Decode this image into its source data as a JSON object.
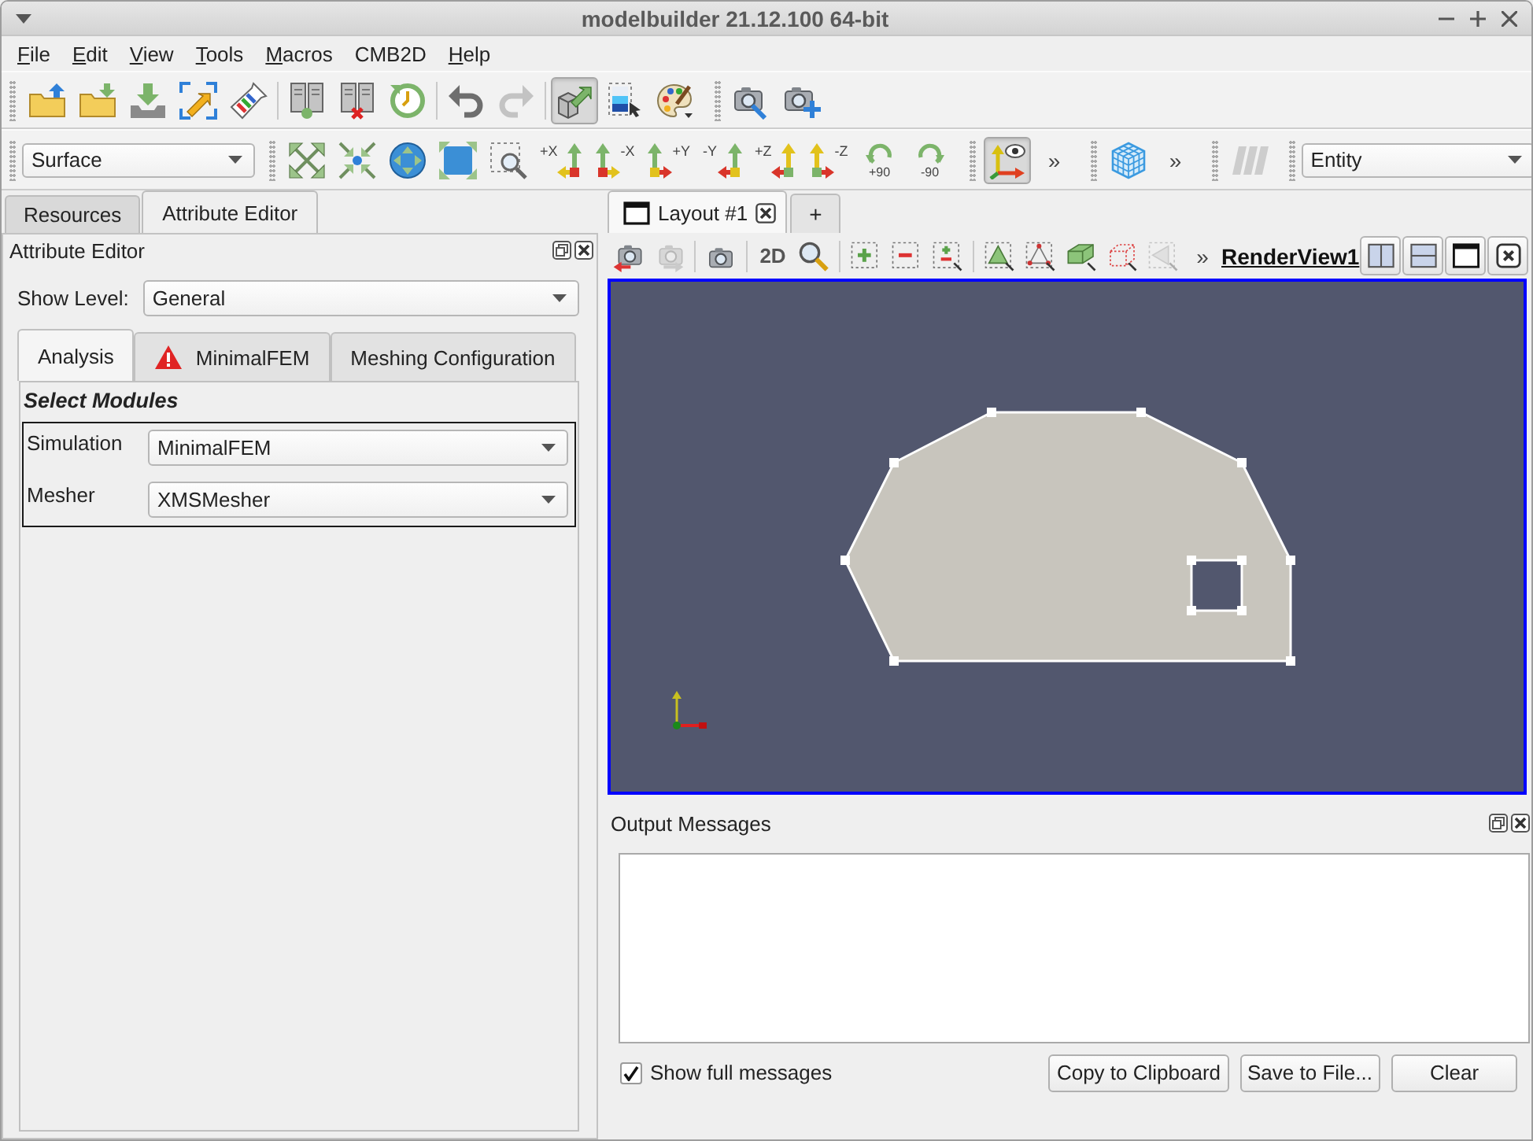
{
  "window": {
    "title": "modelbuilder 21.12.100 64-bit"
  },
  "menu": [
    {
      "label": "File",
      "mnemonic": true
    },
    {
      "label": "Edit",
      "mnemonic": true
    },
    {
      "label": "View",
      "mnemonic": true
    },
    {
      "label": "Tools",
      "mnemonic": true
    },
    {
      "label": "Macros",
      "mnemonic": true
    },
    {
      "label": "CMB2D",
      "mnemonic": false
    },
    {
      "label": "Help",
      "mnemonic": true
    }
  ],
  "toolbar_rows": [
    [
      {
        "groups": [
          [
            {
              "kind": "open",
              "pressed": false,
              "disabled": false
            },
            {
              "kind": "save",
              "pressed": false,
              "disabled": false
            },
            {
              "kind": "import",
              "pressed": false,
              "disabled": false
            },
            {
              "kind": "expand",
              "pressed": false,
              "disabled": false
            },
            {
              "kind": "flask",
              "pressed": false,
              "disabled": false
            }
          ],
          [
            {
              "kind": "connect",
              "pressed": false,
              "disabled": false
            },
            {
              "kind": "disconnect",
              "pressed": false,
              "disabled": false
            },
            {
              "kind": "reload",
              "pressed": false,
              "disabled": false
            }
          ],
          [
            {
              "kind": "undo",
              "pressed": false,
              "disabled": false
            },
            {
              "kind": "redo",
              "pressed": false,
              "disabled": true
            }
          ],
          [
            {
              "kind": "boxarrow",
              "pressed": true,
              "disabled": false
            },
            {
              "kind": "colormap",
              "pressed": false,
              "disabled": false
            },
            {
              "kind": "palette",
              "pressed": false,
              "disabled": false
            }
          ]
        ]
      },
      {
        "groups": [
          [
            {
              "kind": "camsearch",
              "pressed": false,
              "disabled": false
            },
            {
              "kind": "camplus",
              "pressed": false,
              "disabled": false
            }
          ]
        ]
      }
    ],
    [
      {
        "groups": [
          [
            {
              "kind": "combo",
              "value": "Surface"
            }
          ]
        ]
      },
      {
        "groups": [
          [
            {
              "kind": "reset",
              "pressed": false,
              "disabled": false
            },
            {
              "kind": "zoompoint",
              "pressed": false,
              "disabled": false
            },
            {
              "kind": "zoomdata",
              "pressed": false,
              "disabled": false
            },
            {
              "kind": "zoomclosest",
              "pressed": false,
              "disabled": false
            },
            {
              "kind": "zoombox",
              "pressed": false,
              "disabled": false
            },
            {
              "kind": "view-px",
              "label": "+X",
              "pressed": false,
              "disabled": false
            },
            {
              "kind": "view-mx",
              "label": "-X",
              "pressed": false,
              "disabled": false
            },
            {
              "kind": "view-py",
              "label": "+Y",
              "pressed": false,
              "disabled": false
            },
            {
              "kind": "view-my",
              "label": "-Y",
              "pressed": false,
              "disabled": false
            },
            {
              "kind": "view-pz",
              "label": "+Z",
              "pressed": false,
              "disabled": false
            },
            {
              "kind": "view-mz",
              "label": "-Z",
              "pressed": false,
              "disabled": false
            },
            {
              "kind": "rot-p90",
              "label": "+90",
              "pressed": false,
              "disabled": false
            },
            {
              "kind": "rot-m90",
              "label": "-90",
              "pressed": false,
              "disabled": false
            }
          ]
        ]
      },
      {
        "groups": [
          [
            {
              "kind": "eyeaxes",
              "pressed": true,
              "disabled": false
            },
            {
              "kind": "overflow",
              "label": "»"
            }
          ]
        ]
      },
      {
        "groups": [
          [
            {
              "kind": "gridcube",
              "pressed": false,
              "disabled": false
            },
            {
              "kind": "overflow",
              "label": "»"
            }
          ]
        ]
      },
      {
        "groups": [
          [
            {
              "kind": "slashbars",
              "pressed": false,
              "disabled": true
            }
          ]
        ]
      },
      {
        "groups": [
          [
            {
              "kind": "combo",
              "value": "Entity"
            }
          ]
        ]
      }
    ]
  ],
  "left_panel": {
    "tabs": [
      {
        "label": "Resources",
        "selected": false
      },
      {
        "label": "Attribute Editor",
        "selected": true
      }
    ],
    "title": "Attribute Editor",
    "show_level": {
      "label": "Show Level:",
      "value": "General"
    },
    "inner_tabs": [
      {
        "label": "Analysis",
        "selected": true,
        "warning": false
      },
      {
        "label": "MinimalFEM",
        "selected": false,
        "warning": true
      },
      {
        "label": "Meshing Configuration",
        "selected": false,
        "warning": false
      }
    ],
    "section_title": "Select Modules",
    "fields": [
      {
        "label": "Simulation",
        "value": "MinimalFEM"
      },
      {
        "label": "Mesher",
        "value": "XMSMesher"
      }
    ]
  },
  "layout_tabs": [
    {
      "label": "Layout #1",
      "selected": true,
      "closable": true
    },
    {
      "label": "+",
      "selected": false,
      "closable": false
    }
  ],
  "view_toolbar": {
    "groups": [
      [
        {
          "kind": "camundo",
          "pressed": false,
          "disabled": false
        },
        {
          "kind": "camredo",
          "pressed": false,
          "disabled": true
        }
      ],
      [
        {
          "kind": "camera",
          "pressed": false,
          "disabled": false
        }
      ],
      [
        {
          "kind": "text",
          "label": "2D",
          "pressed": false,
          "disabled": false
        },
        {
          "kind": "zoomedit",
          "pressed": false,
          "disabled": false
        }
      ],
      [
        {
          "kind": "selplus",
          "pressed": false,
          "disabled": false
        },
        {
          "kind": "selminus",
          "pressed": false,
          "disabled": false
        },
        {
          "kind": "selpm",
          "pressed": false,
          "disabled": false
        }
      ],
      [
        {
          "kind": "seltri",
          "pressed": false,
          "disabled": false
        },
        {
          "kind": "selpts",
          "pressed": false,
          "disabled": false
        },
        {
          "kind": "selblock",
          "pressed": false,
          "disabled": false
        },
        {
          "kind": "selfrustum",
          "pressed": false,
          "disabled": false
        },
        {
          "kind": "selpoly",
          "pressed": false,
          "disabled": true
        }
      ]
    ],
    "overflow": "»",
    "view_name": "RenderView1",
    "buttons": [
      {
        "kind": "split-h"
      },
      {
        "kind": "split-v"
      },
      {
        "kind": "maximize"
      },
      {
        "kind": "close"
      }
    ]
  },
  "output_messages": {
    "title": "Output Messages",
    "show_full": {
      "label": "Show full messages",
      "checked": true
    },
    "buttons": [
      "Copy to Clipboard",
      "Save to File...",
      "Clear"
    ]
  }
}
